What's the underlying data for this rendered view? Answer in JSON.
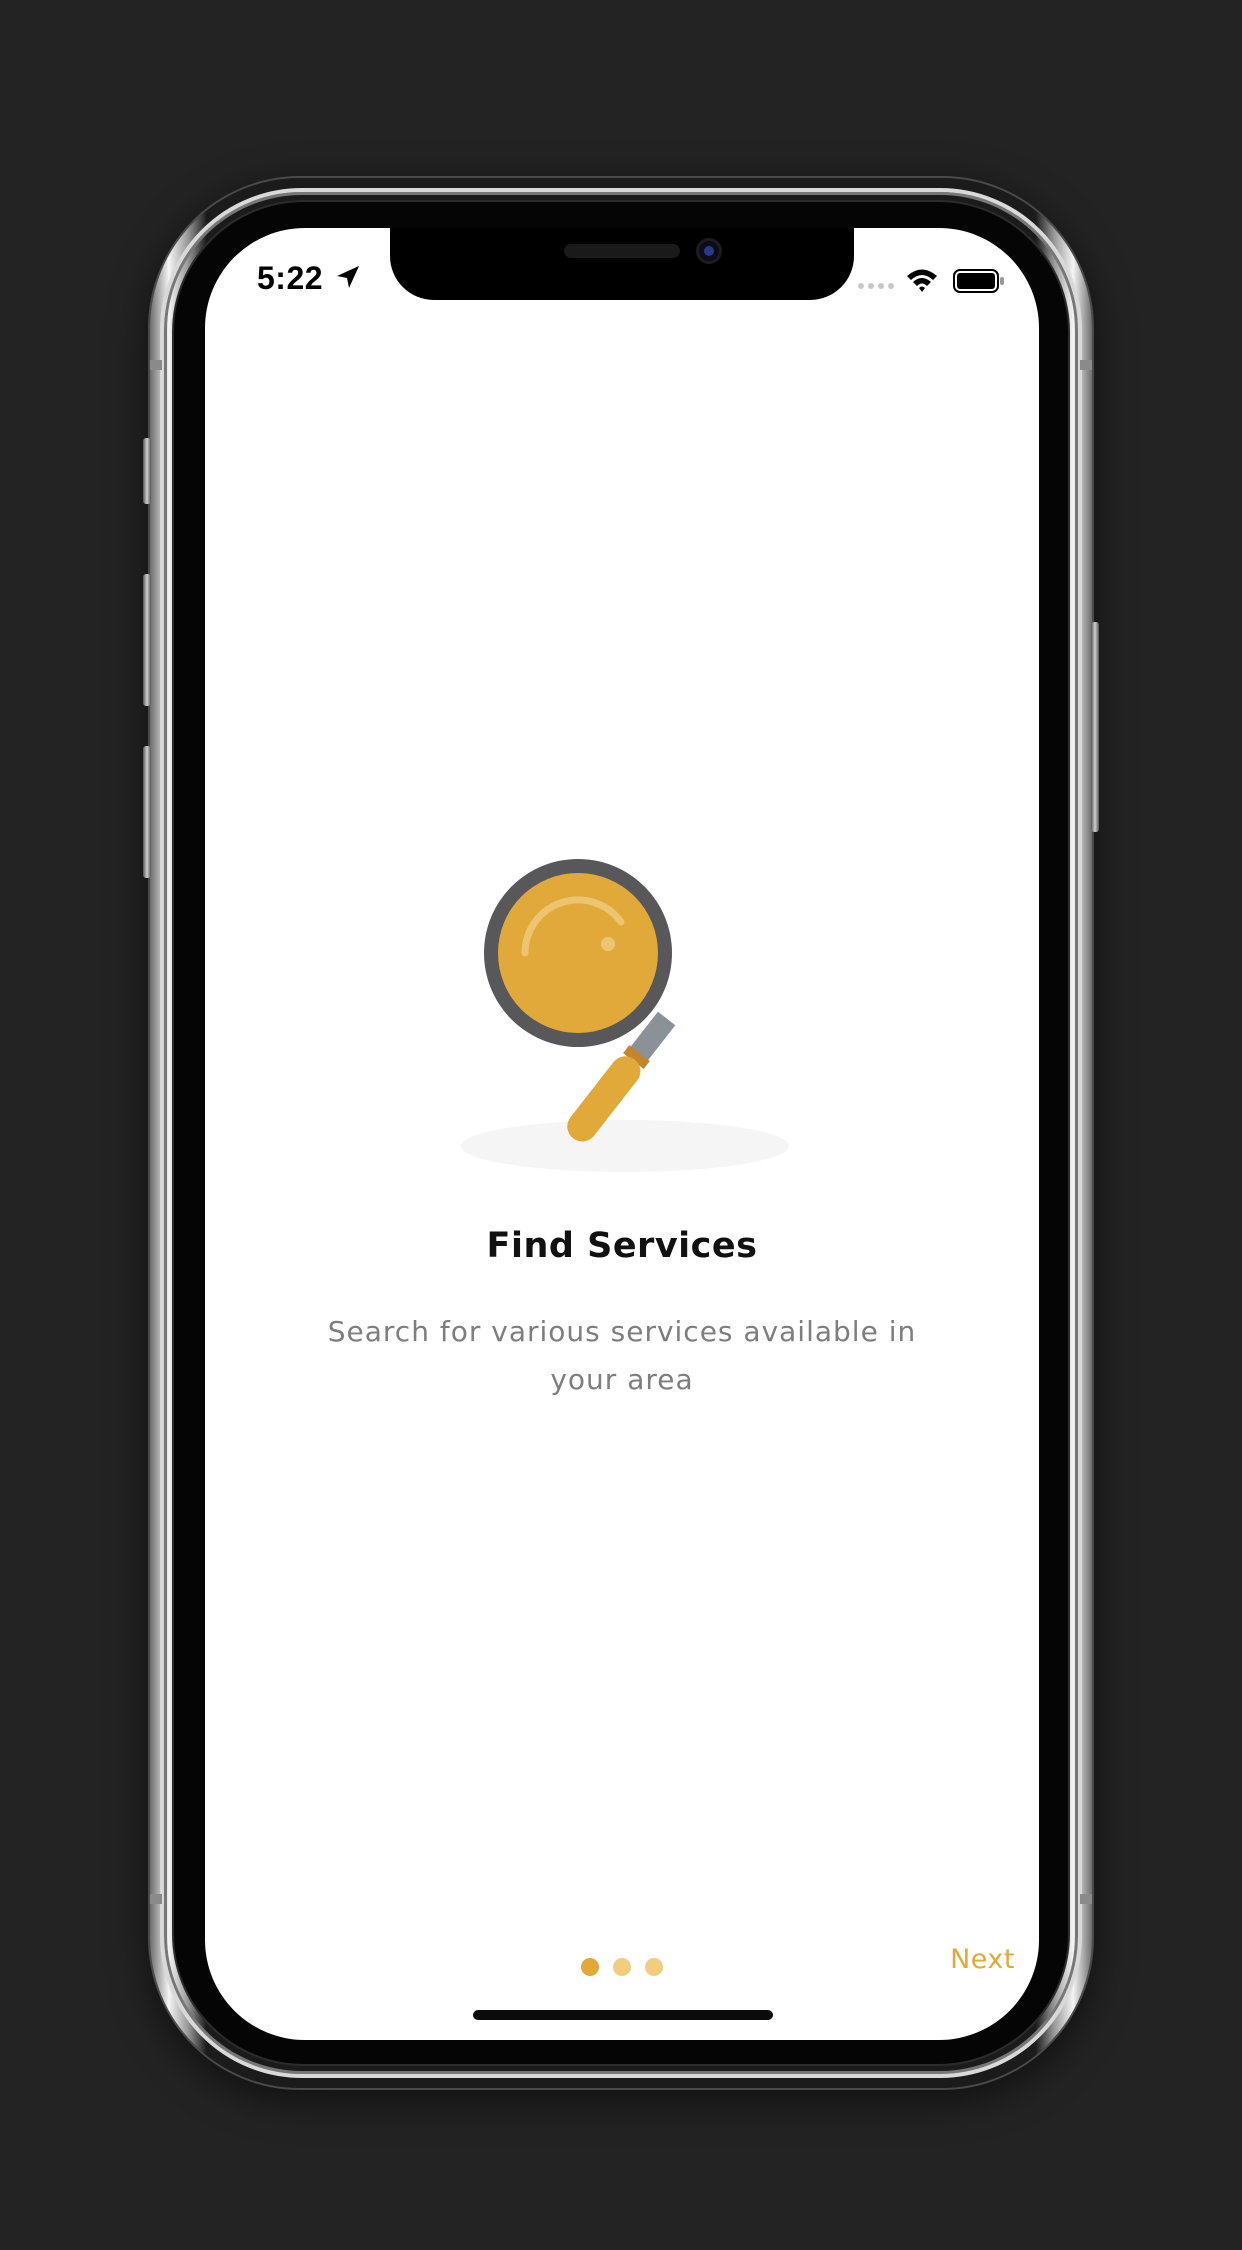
{
  "status_bar": {
    "time": "5:22",
    "icons": [
      "location-arrow-icon",
      "cellular-signal-icon",
      "wifi-icon",
      "battery-icon"
    ]
  },
  "onboarding": {
    "illustration": "magnifying-glass-icon",
    "title": "Find Services",
    "description": "Search for various services available in your area",
    "page_indicator": {
      "total": 3,
      "active": 1
    },
    "next_label": "Next"
  },
  "colors": {
    "accent": "#e0a93a",
    "dot_active": "#e0a93a",
    "dot_inactive": "#f2cd80",
    "background": "#232323",
    "screen": "#ffffff",
    "title": "#111111",
    "description": "#7e7e7e"
  }
}
